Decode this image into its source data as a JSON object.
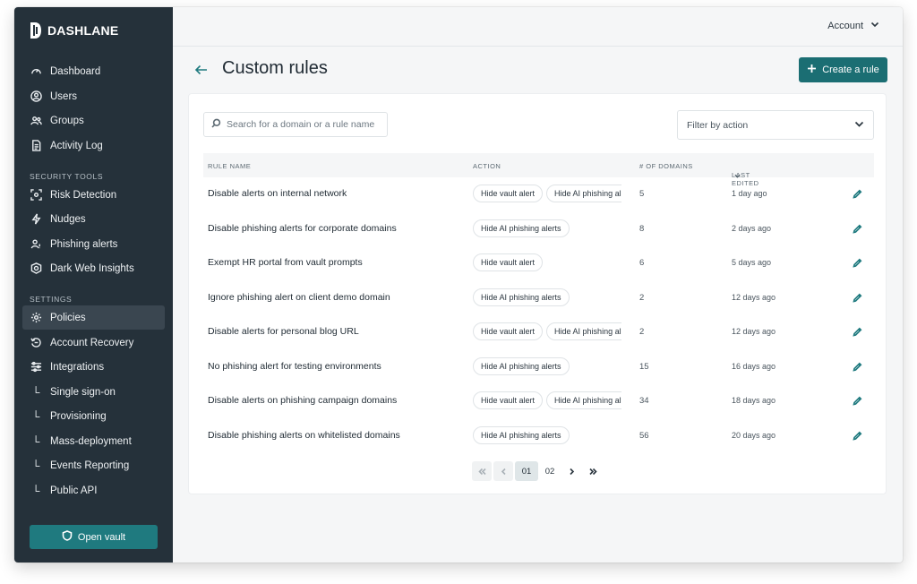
{
  "app": {
    "brand": "DASHLANE"
  },
  "sidebar": {
    "main_items": [
      {
        "label": "Dashboard",
        "icon": "gauge-icon"
      },
      {
        "label": "Users",
        "icon": "user-circle-icon"
      },
      {
        "label": "Groups",
        "icon": "users-group-icon"
      },
      {
        "label": "Activity Log",
        "icon": "document-icon"
      }
    ],
    "security_label": "SECURITY TOOLS",
    "security_items": [
      {
        "label": "Risk Detection",
        "icon": "radar-icon"
      },
      {
        "label": "Nudges",
        "icon": "bolt-icon"
      },
      {
        "label": "Phishing alerts",
        "icon": "phishing-user-icon"
      },
      {
        "label": "Dark Web Insights",
        "icon": "globe-shield-icon"
      }
    ],
    "settings_label": "SETTINGS",
    "settings_items": [
      {
        "label": "Policies",
        "icon": "gear-icon",
        "active": true
      },
      {
        "label": "Account Recovery",
        "icon": "recovery-icon"
      },
      {
        "label": "Integrations",
        "icon": "sliders-icon"
      },
      {
        "label": "Single sign-on",
        "icon": "sub-item-icon"
      },
      {
        "label": "Provisioning",
        "icon": "sub-item-icon"
      },
      {
        "label": "Mass-deployment",
        "icon": "sub-item-icon"
      },
      {
        "label": "Events Reporting",
        "icon": "sub-item-icon"
      },
      {
        "label": "Public API",
        "icon": "sub-item-icon"
      }
    ],
    "open_vault_label": "Open vault"
  },
  "header": {
    "account_label": "Account"
  },
  "page": {
    "title": "Custom rules",
    "create_label": "Create a rule",
    "search_placeholder": "Search for a domain or a rule name",
    "filter_label": "Filter by action"
  },
  "table": {
    "headers": {
      "name": "RULE NAME",
      "action": "ACTION",
      "domains": "# OF DOMAINS",
      "edited": "LAST EDITED"
    },
    "rows": [
      {
        "name": "Disable alerts on internal network",
        "actions": [
          "Hide vault alert",
          "Hide AI phishing alerts"
        ],
        "domains": "5",
        "edited": "1 day ago"
      },
      {
        "name": "Disable phishing alerts for corporate domains",
        "actions": [
          "Hide AI phishing alerts"
        ],
        "domains": "8",
        "edited": "2 days ago"
      },
      {
        "name": "Exempt HR portal from vault prompts",
        "actions": [
          "Hide vault alert"
        ],
        "domains": "6",
        "edited": "5 days ago"
      },
      {
        "name": "Ignore phishing alert on client demo domain",
        "actions": [
          "Hide AI phishing alerts"
        ],
        "domains": "2",
        "edited": "12 days ago"
      },
      {
        "name": "Disable alerts for personal blog URL",
        "actions": [
          "Hide vault alert",
          "Hide AI phishing alerts"
        ],
        "domains": "2",
        "edited": "12 days ago"
      },
      {
        "name": "No phishing alert for testing environments",
        "actions": [
          "Hide AI phishing alerts"
        ],
        "domains": "15",
        "edited": "16 days ago"
      },
      {
        "name": "Disable alerts on phishing campaign domains",
        "actions": [
          "Hide vault alert",
          "Hide AI phishing alerts"
        ],
        "domains": "34",
        "edited": "18 days ago"
      },
      {
        "name": "Disable phishing alerts on whitelisted domains",
        "actions": [
          "Hide AI phishing alerts"
        ],
        "domains": "56",
        "edited": "20 days ago"
      }
    ]
  },
  "pagination": {
    "pages": [
      "01",
      "02"
    ],
    "current": "01"
  },
  "colors": {
    "sidebar_bg": "#25313a",
    "accent": "#1b6e73",
    "active_item": "#3a4650"
  }
}
